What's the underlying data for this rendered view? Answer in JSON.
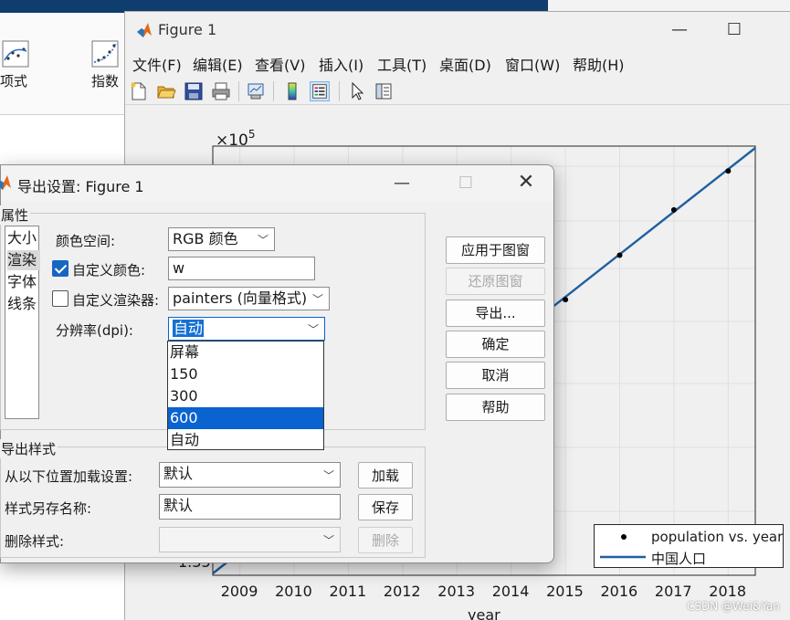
{
  "background_app": {
    "ribbon_items": [
      "项式",
      "指数"
    ]
  },
  "figure": {
    "title": "Figure 1",
    "menu": [
      "文件(F)",
      "编辑(E)",
      "查看(V)",
      "插入(I)",
      "工具(T)",
      "桌面(D)",
      "窗口(W)",
      "帮助(H)"
    ],
    "exponent_base": "×10",
    "exponent_power": "5",
    "ytick_partial": "1.35",
    "xticks": [
      "2009",
      "2010",
      "2011",
      "2012",
      "2013",
      "2014",
      "2015",
      "2016",
      "2017",
      "2018"
    ],
    "xlabel": "year",
    "legend": [
      "population vs. year",
      "中国人口"
    ],
    "watermark": "CSDN @Wei&Yan",
    "colors": {
      "fit_line": "#1f5fa0",
      "data_point": "#000000"
    }
  },
  "chart_data": {
    "type": "scatter",
    "x": [
      2015,
      2016,
      2017,
      2018
    ],
    "series": [
      {
        "name": "population vs. year",
        "values_relative": "points",
        "style": "dots"
      },
      {
        "name": "中国人口",
        "style": "line"
      }
    ],
    "xlabel": "year",
    "xlim": [
      2008.5,
      2018.5
    ]
  },
  "dialog": {
    "title": "导出设置: Figure 1",
    "properties_label": "属性",
    "categories": [
      "大小",
      "渲染",
      "字体",
      "线条"
    ],
    "selected_category": "渲染",
    "colorspace_label": "颜色空间:",
    "colorspace_value": "RGB 颜色",
    "custom_color_label": "自定义颜色:",
    "custom_color_checked": true,
    "custom_color_value": "w",
    "custom_renderer_label": "自定义渲染器:",
    "custom_renderer_checked": false,
    "custom_renderer_value": "painters (向量格式)",
    "resolution_label": "分辨率(dpi):",
    "resolution_value": "自动",
    "resolution_options": [
      "屏幕",
      "150",
      "300",
      "600",
      "自动"
    ],
    "resolution_highlighted": "600",
    "buttons": {
      "apply": "应用于图窗",
      "restore": "还原图窗",
      "export": "导出...",
      "ok": "确定",
      "cancel": "取消",
      "help": "帮助"
    },
    "export_styles_label": "导出样式",
    "load_from_label": "从以下位置加载设置:",
    "load_from_value": "默认",
    "load_button": "加载",
    "save_as_label": "样式另存名称:",
    "save_as_value": "默认",
    "save_button": "保存",
    "delete_label": "删除样式:",
    "delete_value": "",
    "delete_button": "删除"
  }
}
